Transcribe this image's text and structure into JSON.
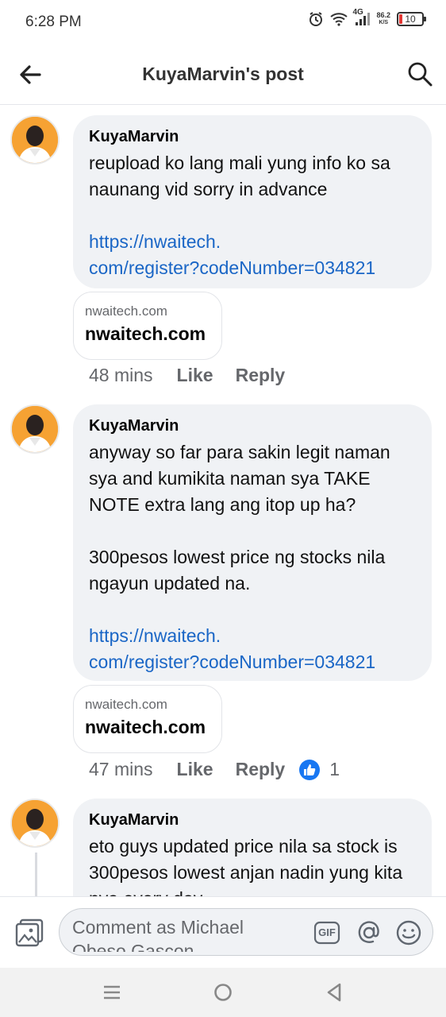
{
  "status_bar": {
    "time": "6:28 PM",
    "network": "4G",
    "speed_value": "86.2",
    "speed_unit": "K/S",
    "battery": "10",
    "icons": [
      "alarm-icon",
      "wifi-icon",
      "signal-icon",
      "battery-icon"
    ]
  },
  "header": {
    "title": "KuyaMarvin's post",
    "back_icon": "arrow-left-icon",
    "search_icon": "search-icon"
  },
  "comments": [
    {
      "author": "KuyaMarvin",
      "text": "reupload ko lang mali yung info ko sa naunang vid sorry in advance",
      "link": "https://nwaitech.\ncom/register?codeNumber=034821",
      "preview_small": "nwaitech.com",
      "preview_big": "nwaitech.com",
      "time": "48 mins",
      "like_label": "Like",
      "reply_label": "Reply"
    },
    {
      "author": "KuyaMarvin",
      "text": "anyway so far para sakin legit naman sya and kumikita naman sya TAKE NOTE extra lang ang itop up ha?\n\n300pesos lowest price ng stocks nila ngayun updated na.",
      "link": "https://nwaitech.\ncom/register?codeNumber=034821",
      "preview_small": "nwaitech.com",
      "preview_big": "nwaitech.com",
      "time": "47 mins",
      "like_label": "Like",
      "reply_label": "Reply",
      "reaction_count": "1"
    },
    {
      "author": "KuyaMarvin",
      "text": "eto guys updated price nila sa stock is 300pesos lowest anjan nadin yung kita nya every day"
    }
  ],
  "composer": {
    "placeholder": "Comment as Michael Obeso Gascon",
    "gif_label": "GIF"
  },
  "colors": {
    "accent": "#1877f2",
    "link": "#1a66c6",
    "bubble": "#f0f2f5",
    "avatar_bg": "#f6a233"
  }
}
